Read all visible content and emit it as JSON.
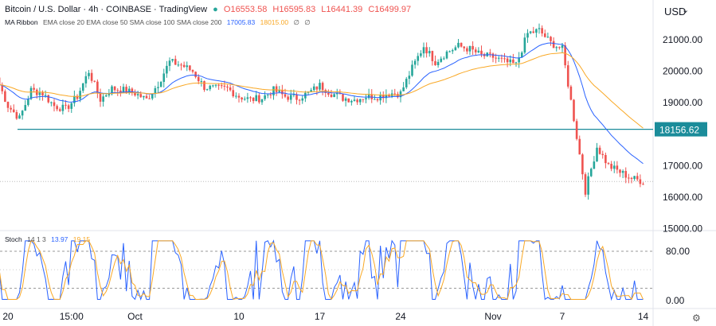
{
  "header": {
    "title": "Bitcoin / U.S. Dollar · 4h · COINBASE · TradingView",
    "o": "O16553.58",
    "h": "H16595.83",
    "l": "L16441.39",
    "c": "C16499.97"
  },
  "ma_legend": {
    "label": "MA Ribbon",
    "params": "EMA close 20 EMA close 50 SMA close 100 SMA close 200",
    "v1": "17005.83",
    "v2": "18015.00",
    "v3": "∅",
    "v4": "∅"
  },
  "stoch_legend": {
    "label": "Stoch",
    "params": "14 1 3",
    "k": "13.97",
    "d": "19.15"
  },
  "currency": "USD",
  "colors": {
    "up": "#26a69a",
    "down": "#ef5350",
    "ema20": "#2962ff",
    "ema50": "#f9a825",
    "level": "#1b8c9a"
  },
  "chart_data": {
    "type": "candlestick",
    "title": "Bitcoin / U.S. Dollar · 4h · COINBASE",
    "x_labels": [
      {
        "day": 0,
        "label": "20"
      },
      {
        "day": 5.5,
        "label": "15:00"
      },
      {
        "day": 11,
        "label": "Oct"
      },
      {
        "day": 20,
        "label": "10"
      },
      {
        "day": 27,
        "label": "17"
      },
      {
        "day": 34,
        "label": "24"
      },
      {
        "day": 42,
        "label": "Nov"
      },
      {
        "day": 48,
        "label": "7"
      },
      {
        "day": 55,
        "label": "14"
      }
    ],
    "y_ticks": [
      15000,
      16000,
      17000,
      19000,
      20000,
      21000
    ],
    "ylim": [
      15000,
      21800
    ],
    "horizontal_level": {
      "value": 18156.62,
      "label": "18156.62"
    },
    "last_price": 16499.97,
    "closes": [
      19800,
      18900,
      18500,
      19400,
      19300,
      18900,
      18800,
      19200,
      20000,
      19100,
      19450,
      19400,
      19300,
      19100,
      19600,
      20300,
      20200,
      20000,
      19500,
      19450,
      19450,
      19200,
      19100,
      19150,
      19400,
      19200,
      19150,
      19300,
      19550,
      19300,
      19150,
      19100,
      19200,
      19200,
      19300,
      19300,
      20100,
      20800,
      20300,
      20600,
      20800,
      20700,
      20500,
      20450,
      20300,
      20200,
      21200,
      21300,
      20900,
      20700,
      18500,
      16200,
      17600,
      17000,
      16800,
      16600,
      16500
    ],
    "first_day": -1,
    "stoch": {
      "levels": [
        80,
        20
      ],
      "ylim": [
        0,
        100
      ],
      "ticks": [
        0,
        80
      ],
      "tick_labels": [
        "0.00",
        "80.00"
      ]
    }
  }
}
